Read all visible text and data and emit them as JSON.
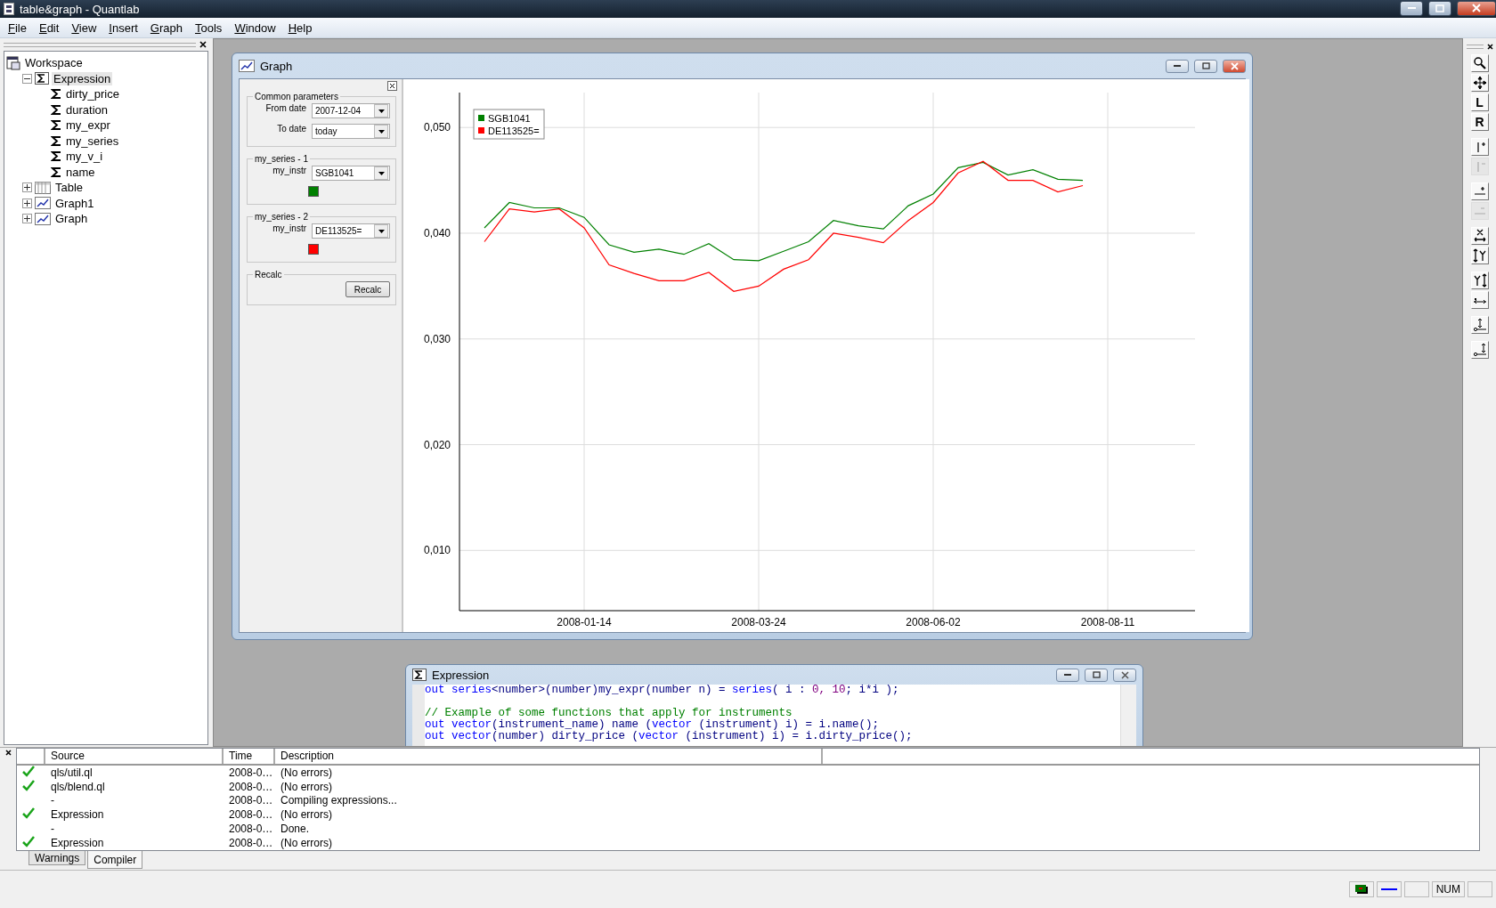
{
  "window": {
    "title": "table&graph - Quantlab"
  },
  "menu": [
    {
      "label": "File"
    },
    {
      "label": "Edit"
    },
    {
      "label": "View"
    },
    {
      "label": "Insert"
    },
    {
      "label": "Graph"
    },
    {
      "label": "Tools"
    },
    {
      "label": "Window"
    },
    {
      "label": "Help"
    }
  ],
  "workspace": {
    "tree": [
      {
        "label": "Workspace",
        "kind": "workspace",
        "selected": false,
        "children": [
          {
            "label": "Expression",
            "kind": "expression",
            "expanded": true,
            "selected": true,
            "children": [
              {
                "label": "dirty_price",
                "kind": "function",
                "selected": false
              },
              {
                "label": "duration",
                "kind": "function",
                "selected": false
              },
              {
                "label": "my_expr",
                "kind": "function",
                "selected": false
              },
              {
                "label": "my_series",
                "kind": "function",
                "selected": false
              },
              {
                "label": "my_v_i",
                "kind": "function",
                "selected": false
              },
              {
                "label": "name",
                "kind": "function",
                "selected": false
              }
            ]
          },
          {
            "label": "Table",
            "kind": "table",
            "expanded": false,
            "selected": false
          },
          {
            "label": "Graph1",
            "kind": "graph",
            "expanded": false,
            "selected": false
          },
          {
            "label": "Graph",
            "kind": "graph",
            "expanded": false,
            "selected": false
          }
        ]
      }
    ]
  },
  "graph_window": {
    "title": "Graph",
    "params": [
      {
        "kind": "fields",
        "title": "Common parameters",
        "fields": [
          {
            "label": "From date",
            "value": "2007-12-04"
          },
          {
            "label": "To date",
            "value": "today"
          }
        ]
      },
      {
        "kind": "fields",
        "title": "my_series - 1",
        "fields": [
          {
            "label": "my_instr",
            "value": "SGB1041"
          }
        ],
        "color": "#008000"
      },
      {
        "kind": "fields",
        "title": "my_series - 2",
        "fields": [
          {
            "label": "my_instr",
            "value": "DE113525="
          }
        ],
        "color": "#ff0000"
      },
      {
        "kind": "button",
        "title": "Recalc",
        "button": "Recalc"
      }
    ],
    "chart_data": {
      "type": "line",
      "categories": [
        null,
        null,
        null,
        null,
        "2008-01-14",
        null,
        null,
        null,
        null,
        null,
        null,
        "2008-03-24",
        null,
        null,
        null,
        null,
        null,
        null,
        "2008-06-02",
        null,
        null,
        null,
        null,
        null,
        null,
        "2008-08-11"
      ],
      "series": [
        {
          "name": "SGB1041",
          "color": "#008000",
          "values": [
            0.0405,
            0.0429,
            0.0424,
            0.0424,
            0.0415,
            0.0389,
            0.0382,
            0.0385,
            0.038,
            0.039,
            0.0375,
            0.0374,
            0.0383,
            0.0392,
            0.0412,
            0.0407,
            0.0404,
            0.0426,
            0.0437,
            0.0462,
            0.0467,
            0.0455,
            0.046,
            0.0451,
            0.045,
            null
          ]
        },
        {
          "name": "DE113525=",
          "color": "#ff0000",
          "values": [
            0.0392,
            0.0423,
            0.042,
            0.0423,
            0.0405,
            0.037,
            0.0362,
            0.0355,
            0.0355,
            0.0363,
            0.0345,
            0.035,
            0.0366,
            0.0375,
            0.04,
            0.0396,
            0.0391,
            0.0412,
            0.0429,
            0.0457,
            0.0468,
            0.045,
            0.045,
            0.0439,
            0.0445,
            null
          ]
        }
      ],
      "ylim": [
        0.0043,
        0.0533
      ],
      "grid": true,
      "legend": "upper left",
      "yticks": [
        {
          "value": 0.01,
          "label": "0,010"
        },
        {
          "value": 0.02,
          "label": "0,020"
        },
        {
          "value": 0.03,
          "label": "0,030"
        },
        {
          "value": 0.04,
          "label": "0,040"
        },
        {
          "value": 0.05,
          "label": "0,050"
        }
      ]
    }
  },
  "expression_window": {
    "title": "Expression",
    "lines": [
      {
        "kind": "code",
        "tokens": [
          {
            "kind": "keyword",
            "text": "out series"
          },
          {
            "kind": "plain",
            "text": "<number>(number)my_expr(number n) = "
          },
          {
            "kind": "keyword",
            "text": "series"
          },
          {
            "kind": "plain",
            "text": "( i : "
          },
          {
            "kind": "number",
            "text": "0, 10"
          },
          {
            "kind": "plain",
            "text": "; i*i );"
          }
        ]
      },
      {
        "kind": "blank"
      },
      {
        "kind": "code",
        "tokens": [
          {
            "kind": "comment",
            "text": "// Example of some functions that apply for instruments"
          }
        ]
      },
      {
        "kind": "code",
        "tokens": [
          {
            "kind": "keyword",
            "text": "out vector"
          },
          {
            "kind": "plain",
            "text": "(instrument_name) name ("
          },
          {
            "kind": "keyword",
            "text": "vector"
          },
          {
            "kind": "plain",
            "text": " (instrument) i) = i.name();"
          }
        ]
      },
      {
        "kind": "code",
        "tokens": [
          {
            "kind": "keyword",
            "text": "out vector"
          },
          {
            "kind": "plain",
            "text": "(number) dirty_price ("
          },
          {
            "kind": "keyword",
            "text": "vector"
          },
          {
            "kind": "plain",
            "text": " (instrument) i) = i.dirty_price();"
          }
        ]
      }
    ]
  },
  "messages": {
    "columns": [
      "Source",
      "Time",
      "Description"
    ],
    "rows": [
      {
        "ok": true,
        "source": "qls/util.ql",
        "time": "2008-0…",
        "description": "(No errors)"
      },
      {
        "ok": true,
        "source": "qls/blend.ql",
        "time": "2008-0…",
        "description": "(No errors)"
      },
      {
        "ok": false,
        "source": "-",
        "time": "2008-0…",
        "description": "Compiling expressions..."
      },
      {
        "ok": true,
        "source": "Expression",
        "time": "2008-0…",
        "description": "(No errors)"
      },
      {
        "ok": false,
        "source": "-",
        "time": "2008-0…",
        "description": "Done."
      },
      {
        "ok": true,
        "source": "Expression",
        "time": "2008-0…",
        "description": "(No errors)"
      }
    ],
    "tabs": [
      {
        "label": "Warnings",
        "selected": false
      },
      {
        "label": "Compiler",
        "selected": true
      }
    ]
  },
  "toolbar": {
    "buttons": [
      {
        "disabled": false
      },
      {
        "disabled": false
      },
      {
        "label": "L",
        "disabled": false
      },
      {
        "label": "R",
        "disabled": false
      },
      {
        "disabled": false
      },
      {
        "disabled": true
      },
      {
        "disabled": false
      },
      {
        "disabled": true
      },
      {
        "disabled": false
      },
      {
        "disabled": false
      },
      {
        "disabled": false
      },
      {
        "disabled": false
      },
      {
        "disabled": false
      },
      {
        "disabled": false
      }
    ]
  },
  "status_bar": {
    "indicators": [
      "NUM"
    ]
  }
}
